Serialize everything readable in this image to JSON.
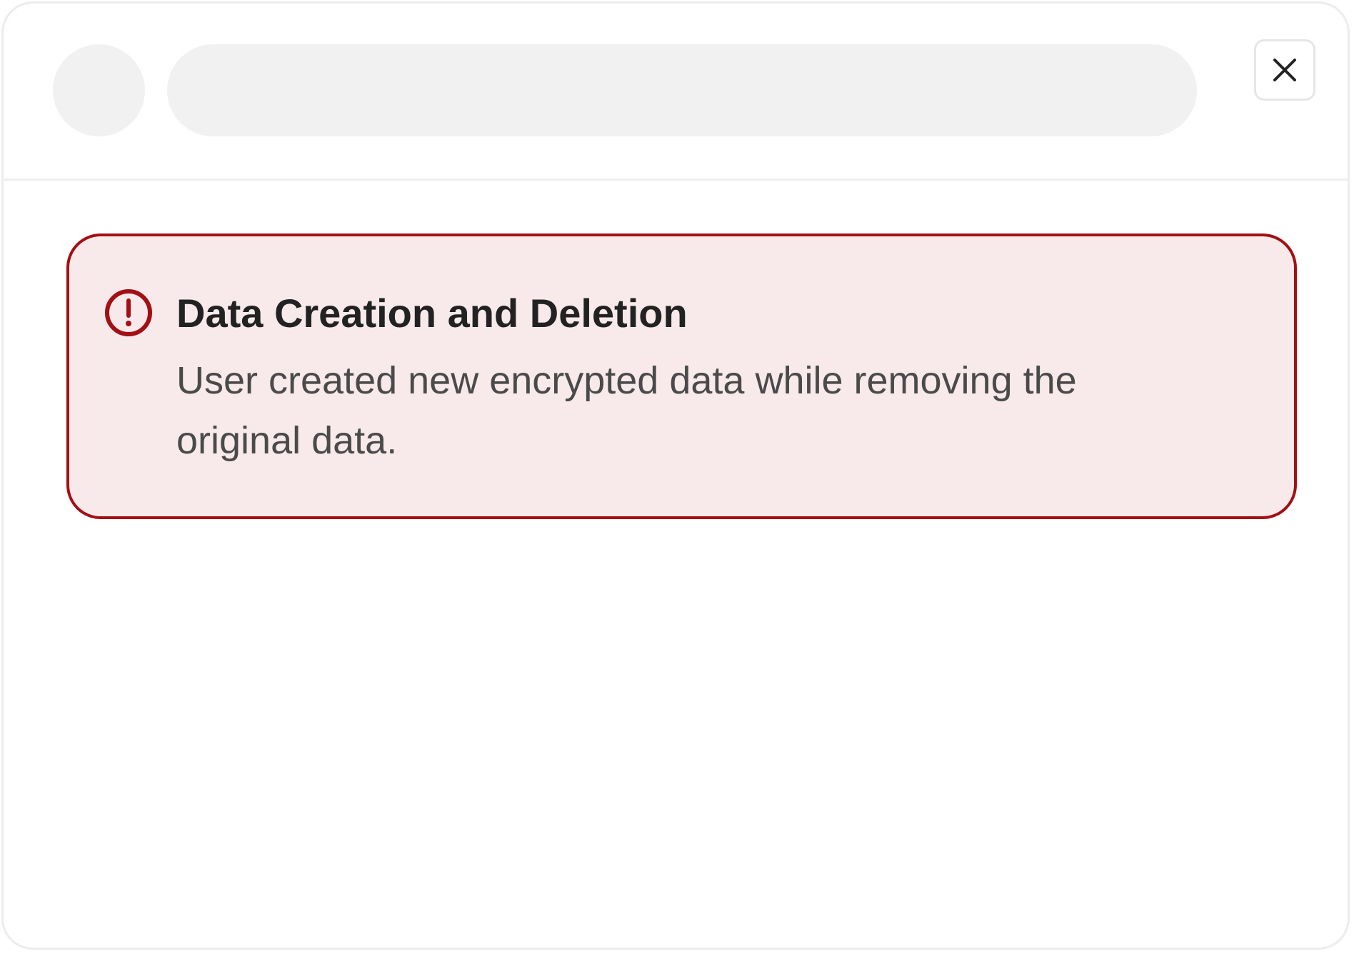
{
  "header": {
    "close_icon": "close-icon"
  },
  "alert": {
    "icon": "exclamation-circle-icon",
    "title": "Data Creation and Deletion",
    "message": "User created new encrypted data while removing the original data.",
    "accent_color": "#a30f14",
    "background_color": "#f8eaeb"
  }
}
